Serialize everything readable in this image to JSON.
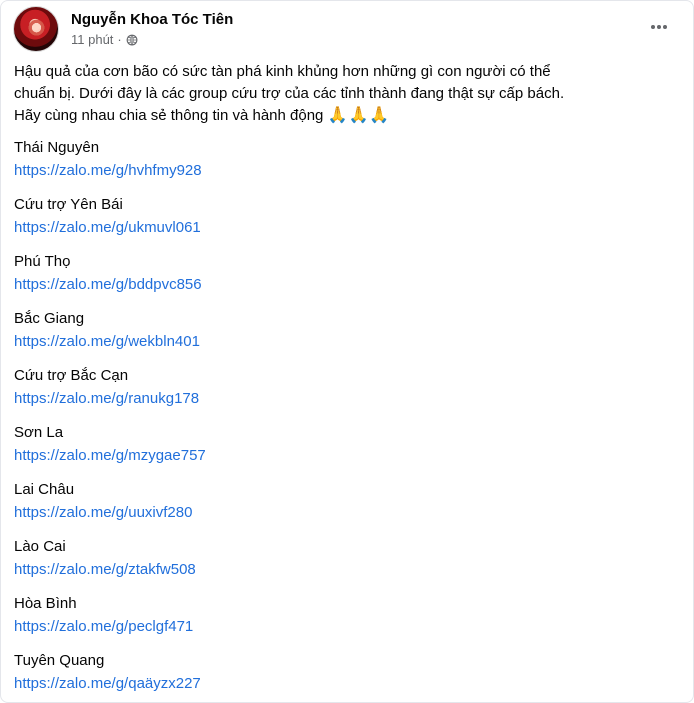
{
  "post": {
    "author": "Nguyễn Khoa Tóc Tiên",
    "time": "11 phút",
    "separator": "·",
    "audience_icon": "globe-icon",
    "more_icon": "more-options-icon",
    "intro_lines": [
      "Hậu quả của cơn bão có sức tàn phá kinh khủng hơn những gì con người có thể",
      "chuẩn bị. Dưới đây là các group cứu trợ của các tỉnh thành đang thật sự cấp bách.",
      "Hãy cùng nhau chia sẻ thông tin và hành động"
    ],
    "emoji": "🙏🙏🙏",
    "groups": [
      {
        "name": "Thái Nguyên",
        "link": "https://zalo.me/g/hvhfmy928"
      },
      {
        "name": "Cứu trợ Yên Bái",
        "link": "https://zalo.me/g/ukmuvl061"
      },
      {
        "name": "Phú Thọ",
        "link": "https://zalo.me/g/bddpvc856"
      },
      {
        "name": "Bắc Giang",
        "link": "https://zalo.me/g/wekbln401"
      },
      {
        "name": "Cứu trợ Bắc Cạn",
        "link": "https://zalo.me/g/ranukg178"
      },
      {
        "name": "Sơn La",
        "link": "https://zalo.me/g/mzygae757"
      },
      {
        "name": "Lai Châu",
        "link": "https://zalo.me/g/uuxivf280"
      },
      {
        "name": "Lào Cai",
        "link": "https://zalo.me/g/ztakfw508"
      },
      {
        "name": "Hòa Bình",
        "link": "https://zalo.me/g/peclgf471"
      },
      {
        "name": "Tuyên Quang",
        "link": "https://zalo.me/g/qaäyzx227"
      }
    ]
  },
  "colors": {
    "text": "#050505",
    "muted": "#65676b",
    "link": "#216fdb"
  }
}
